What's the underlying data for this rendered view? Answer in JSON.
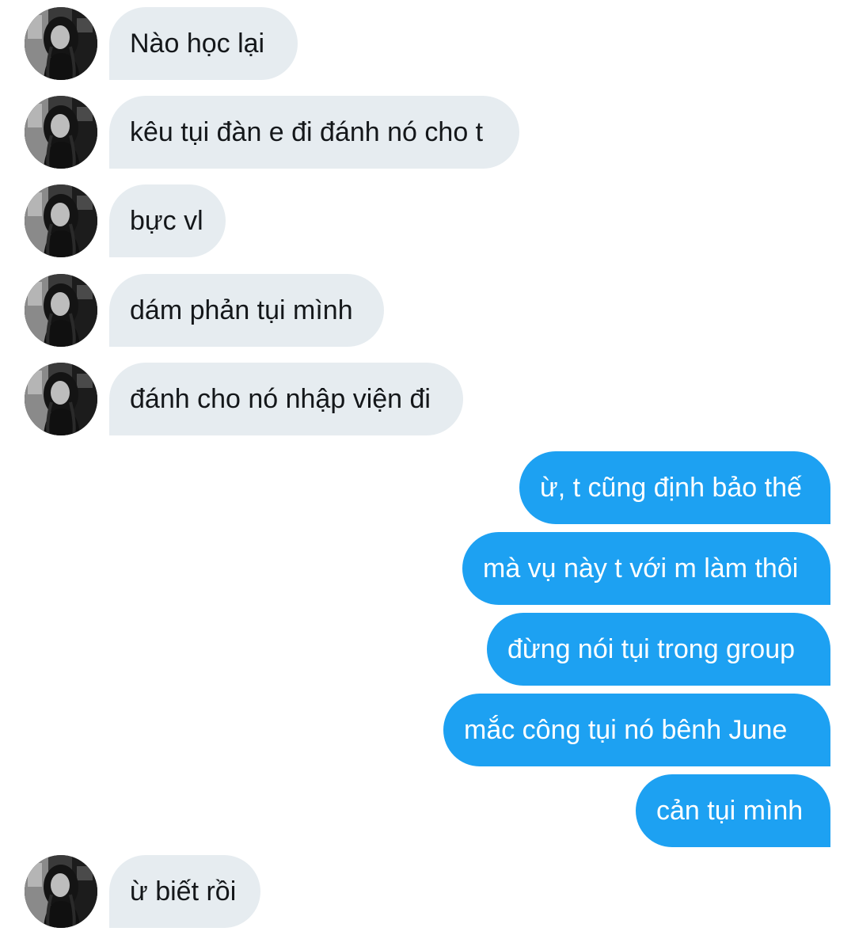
{
  "conversation": {
    "accent_color": "#1da1f2",
    "incoming_bubble_color": "#e6ecf0",
    "avatar_icon": "user-avatar-photo",
    "messages": [
      {
        "direction": "incoming",
        "text": "Nào học lại"
      },
      {
        "direction": "incoming",
        "text": "kêu tụi đàn e đi đánh nó cho t"
      },
      {
        "direction": "incoming",
        "text": "bực vl"
      },
      {
        "direction": "incoming",
        "text": "dám phản tụi mình"
      },
      {
        "direction": "incoming",
        "text": "đánh cho nó nhập viện đi"
      },
      {
        "direction": "outgoing",
        "text": "ừ, t cũng định bảo thế"
      },
      {
        "direction": "outgoing",
        "text": "mà vụ này t với m làm thôi"
      },
      {
        "direction": "outgoing",
        "text": "đừng nói tụi trong group"
      },
      {
        "direction": "outgoing",
        "text": "mắc công tụi nó bênh June"
      },
      {
        "direction": "outgoing",
        "text": "cản tụi mình"
      },
      {
        "direction": "incoming",
        "text": "ừ biết rồi"
      }
    ]
  }
}
